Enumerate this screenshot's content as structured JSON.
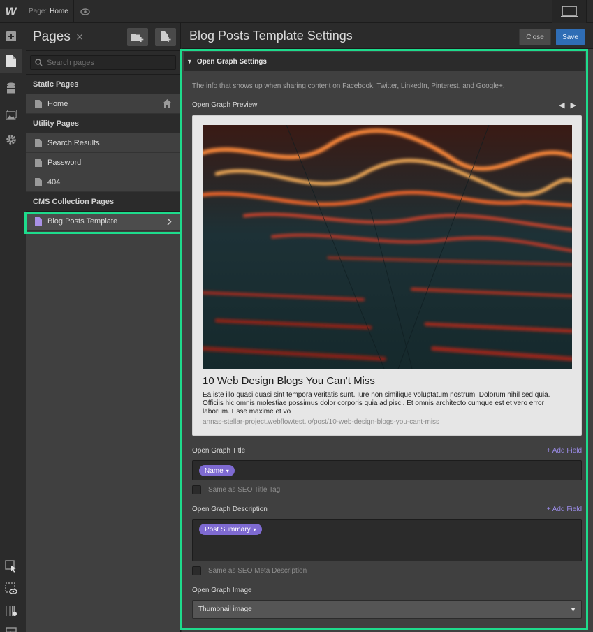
{
  "topbar": {
    "logo": "W",
    "page_label": "Page:",
    "page_value": "Home"
  },
  "pages_panel": {
    "title": "Pages",
    "search_placeholder": "Search pages",
    "sections": [
      {
        "heading": "Static Pages",
        "items": [
          "Home"
        ]
      },
      {
        "heading": "Utility Pages",
        "items": [
          "Search Results",
          "Password",
          "404"
        ]
      },
      {
        "heading": "CMS Collection Pages",
        "items": [
          "Blog Posts Template"
        ]
      }
    ]
  },
  "settings": {
    "title": "Blog Posts Template Settings",
    "close_label": "Close",
    "save_label": "Save",
    "og": {
      "section_title": "Open Graph Settings",
      "description": "The info that shows up when sharing content on Facebook, Twitter, LinkedIn, Pinterest, and Google+.",
      "preview_label": "Open Graph Preview",
      "preview": {
        "title": "10 Web Design Blogs You Can't Miss",
        "text": "Ea iste illo quasi quasi sint tempora veritatis sunt. Iure non similique voluptatum nostrum. Dolorum nihil sed quia. Officiis hic omnis molestiae possimus dolor corporis quia adipisci. Et omnis architecto cumque est et vero error laborum. Esse maxime et vo",
        "url": "annas-stellar-project.webflowtest.io/post/10-web-design-blogs-you-cant-miss"
      },
      "title_label": "Open Graph Title",
      "add_field": "+ Add Field",
      "title_chip": "Name",
      "same_title": "Same as SEO Title Tag",
      "desc_label": "Open Graph Description",
      "desc_chip": "Post Summary",
      "same_desc": "Same as SEO Meta Description",
      "image_label": "Open Graph Image",
      "image_value": "Thumbnail image"
    }
  },
  "colors": {
    "highlight": "#1edb8c",
    "save": "#2f6db5",
    "chip": "#7e6ad1"
  }
}
